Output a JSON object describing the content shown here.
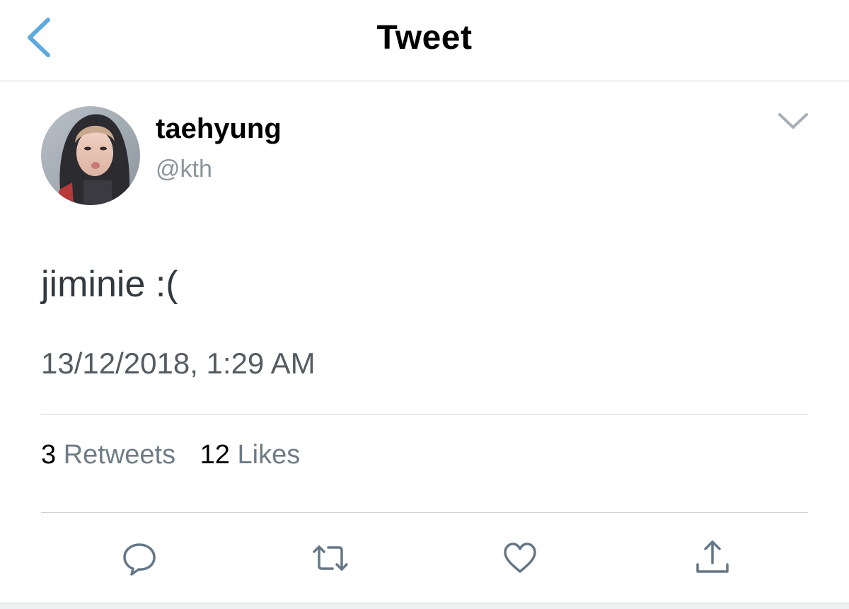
{
  "nav": {
    "title": "Tweet",
    "back_icon": "chevron-left-icon"
  },
  "tweet": {
    "display_name": "taehyung",
    "handle": "@kth",
    "text": "jiminie :(",
    "timestamp": "13/12/2018, 1:29 AM",
    "more_icon": "chevron-down-icon"
  },
  "stats": {
    "retweets_count": "3",
    "retweets_label": "Retweets",
    "likes_count": "12",
    "likes_label": "Likes"
  },
  "actions": {
    "reply_icon": "reply-icon",
    "retweet_icon": "retweet-icon",
    "like_icon": "heart-icon",
    "share_icon": "share-icon"
  },
  "colors": {
    "accent": "#5ea9dd",
    "icon_gray": "#657786",
    "divider": "#cdd3d7"
  }
}
